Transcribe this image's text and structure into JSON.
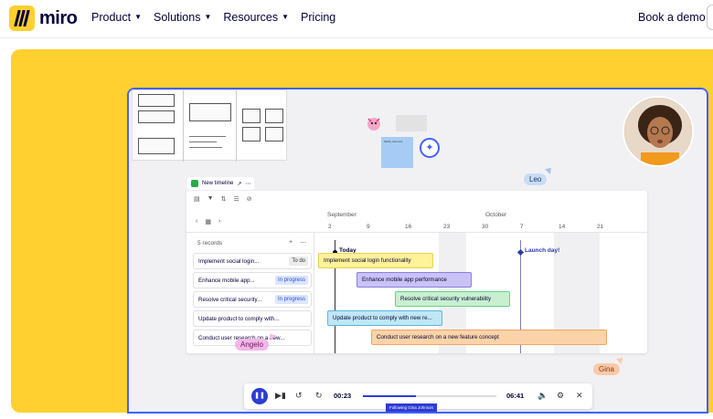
{
  "brand": {
    "name": "miro",
    "color": "#ffd02f"
  },
  "nav": {
    "items": [
      {
        "label": "Product",
        "has_dropdown": true
      },
      {
        "label": "Solutions",
        "has_dropdown": true
      },
      {
        "label": "Resources",
        "has_dropdown": true
      },
      {
        "label": "Pricing",
        "has_dropdown": false
      }
    ],
    "book_demo": "Book a demo"
  },
  "board": {
    "timeline_name": "New timeline",
    "records_label": "5 records",
    "months": [
      "September",
      "October"
    ],
    "days": [
      "2",
      "9",
      "16",
      "23",
      "30",
      "7",
      "14",
      "21"
    ],
    "today_label": "Today",
    "milestone_label": "Launch day!",
    "tasks": [
      {
        "name": "Implement social login...",
        "status": "To do",
        "bar": "Implement social login functionality",
        "color": "#fff29a",
        "border": "#e6d24a"
      },
      {
        "name": "Enhance mobile app...",
        "status": "In progress",
        "bar": "Enhance mobile app performance",
        "color": "#c9c3f5",
        "border": "#8a7fe0"
      },
      {
        "name": "Resolve critical security...",
        "status": "In progress",
        "bar": "Resolve critical security vulnerability",
        "color": "#c8f0d0",
        "border": "#6bcf85"
      },
      {
        "name": "Update product to comply with...",
        "status": "",
        "bar": "Update product to comply with new re...",
        "color": "#bfe7f5",
        "border": "#5ab8dd"
      },
      {
        "name": "Conduct user research on a new...",
        "status": "",
        "bar": "Conduct user research on a new feature concept",
        "color": "#fcd3a8",
        "border": "#f0a565"
      }
    ],
    "collaborators": [
      "Leo",
      "Angelo",
      "Gina"
    ],
    "sticky_text": "Sticky note text",
    "player": {
      "current": "00:23",
      "total": "06:41",
      "progress": 0.4,
      "following": "Following Gina Johnson"
    }
  }
}
